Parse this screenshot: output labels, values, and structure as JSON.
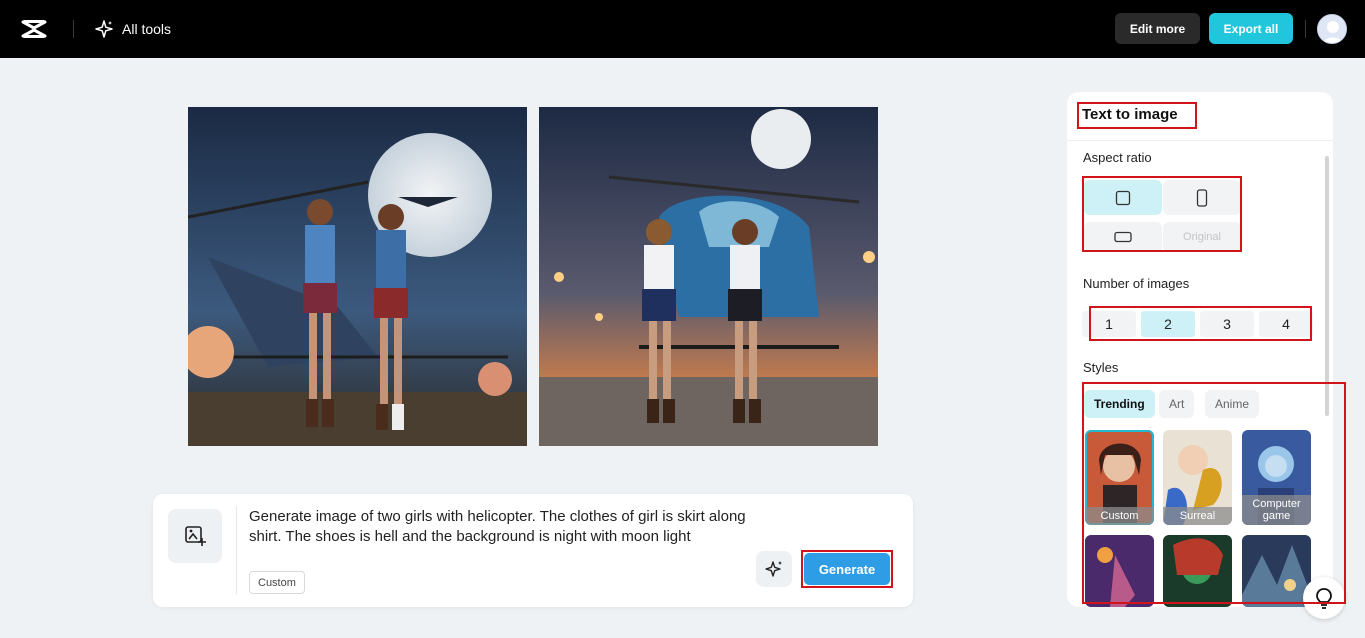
{
  "topbar": {
    "all_tools_label": "All tools",
    "edit_more_label": "Edit more",
    "export_all_label": "Export all",
    "accent_color": "#22c6dc"
  },
  "prompt": {
    "text": "Generate image of two girls with helicopter. The clothes of girl is skirt along shirt. The shoes is hell and the background is night with moon light",
    "style_chip": "Custom",
    "generate_label": "Generate"
  },
  "panel": {
    "title": "Text to image",
    "aspect_ratio_label": "Aspect ratio",
    "aspect_ratio_options": [
      {
        "name": "square",
        "selected": true
      },
      {
        "name": "portrait",
        "selected": false
      },
      {
        "name": "landscape",
        "selected": false
      },
      {
        "name": "original",
        "label": "Original",
        "selected": false
      }
    ],
    "number_of_images_label": "Number of images",
    "number_options": [
      "1",
      "2",
      "3",
      "4"
    ],
    "selected_number": "2",
    "styles_label": "Styles",
    "style_tabs": [
      "Trending",
      "Art",
      "Anime"
    ],
    "selected_style_tab": "Trending",
    "style_cards": [
      {
        "label": "Custom",
        "selected": true
      },
      {
        "label": "Surreal",
        "selected": false
      },
      {
        "label": "Computer game",
        "selected": false
      }
    ]
  }
}
